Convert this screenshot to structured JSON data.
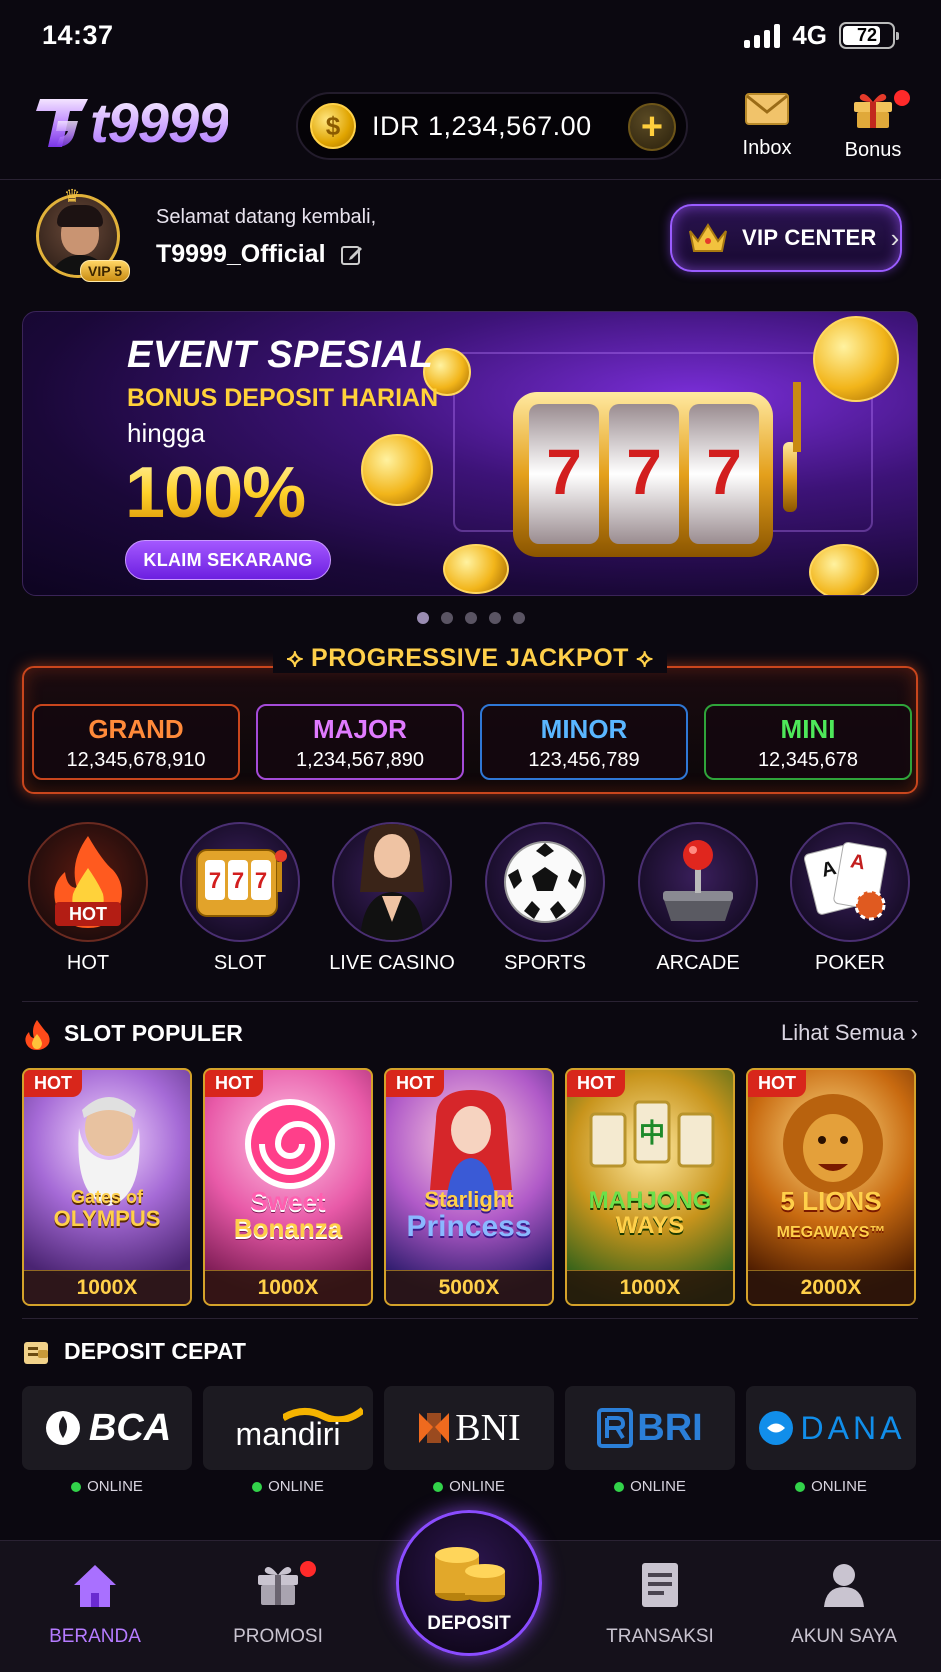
{
  "status_bar": {
    "time": "14:37",
    "network": "4G",
    "battery": "72"
  },
  "header": {
    "logo_text": "t9999",
    "balance": "IDR 1,234,567.00",
    "add_symbol": "+",
    "inbox_label": "Inbox",
    "bonus_label": "Bonus"
  },
  "profile": {
    "welcome": "Selamat datang kembali,",
    "username": "T9999_Official",
    "vip_level": "VIP 5",
    "vip_center": "VIP CENTER"
  },
  "banner": {
    "title": "EVENT SPESIAL",
    "subtitle": "BONUS DEPOSIT HARIAN",
    "upto": "hingga",
    "percent": "100%",
    "cta": "KLAIM SEKARANG",
    "slides": 5,
    "active_slide": 1
  },
  "jackpot": {
    "title": "PROGRESSIVE JACKPOT",
    "tiers": [
      {
        "name": "GRAND",
        "value": "12,345,678,910",
        "color": "#ff8a3a"
      },
      {
        "name": "MAJOR",
        "value": "1,234,567,890",
        "color": "#e07bff"
      },
      {
        "name": "MINOR",
        "value": "123,456,789",
        "color": "#5ab6ff"
      },
      {
        "name": "MINI",
        "value": "12,345,678",
        "color": "#4ee85a"
      }
    ]
  },
  "categories": [
    {
      "label": "HOT",
      "icon": "flame-icon",
      "badge": "HOT"
    },
    {
      "label": "SLOT",
      "icon": "slot-machine-icon"
    },
    {
      "label": "LIVE CASINO",
      "icon": "dealer-icon"
    },
    {
      "label": "SPORTS",
      "icon": "soccer-ball-icon"
    },
    {
      "label": "ARCADE",
      "icon": "joystick-icon"
    },
    {
      "label": "POKER",
      "icon": "cards-icon"
    }
  ],
  "slot_populer": {
    "title": "SLOT POPULER",
    "see_all": "Lihat Semua",
    "games": [
      {
        "badge": "HOT",
        "name_line1": "Gates of",
        "name_line2": "OLYMPUS",
        "multiplier": "1000X"
      },
      {
        "badge": "HOT",
        "name_line1": "Sweet",
        "name_line2": "Bonanza",
        "multiplier": "1000X"
      },
      {
        "badge": "HOT",
        "name_line1": "Starlight",
        "name_line2": "Princess",
        "multiplier": "5000X"
      },
      {
        "badge": "HOT",
        "name_line1": "MAHJONG",
        "name_line2": "WAYS",
        "multiplier": "1000X"
      },
      {
        "badge": "HOT",
        "name_line1": "5 LIONS",
        "name_line2": "MEGAWAYS™",
        "multiplier": "2000X"
      }
    ]
  },
  "deposit": {
    "title": "DEPOSIT CEPAT",
    "banks": [
      {
        "name": "BCA",
        "status": "ONLINE"
      },
      {
        "name": "mandiri",
        "status": "ONLINE"
      },
      {
        "name": "BNI",
        "status": "ONLINE"
      },
      {
        "name": "BRI",
        "status": "ONLINE"
      },
      {
        "name": "DANA",
        "status": "ONLINE"
      }
    ]
  },
  "bottom_nav": {
    "beranda": "BERANDA",
    "promosi": "PROMOSI",
    "deposit": "DEPOSIT",
    "transaksi": "TRANSAKSI",
    "akun": "AKUN SAYA"
  }
}
